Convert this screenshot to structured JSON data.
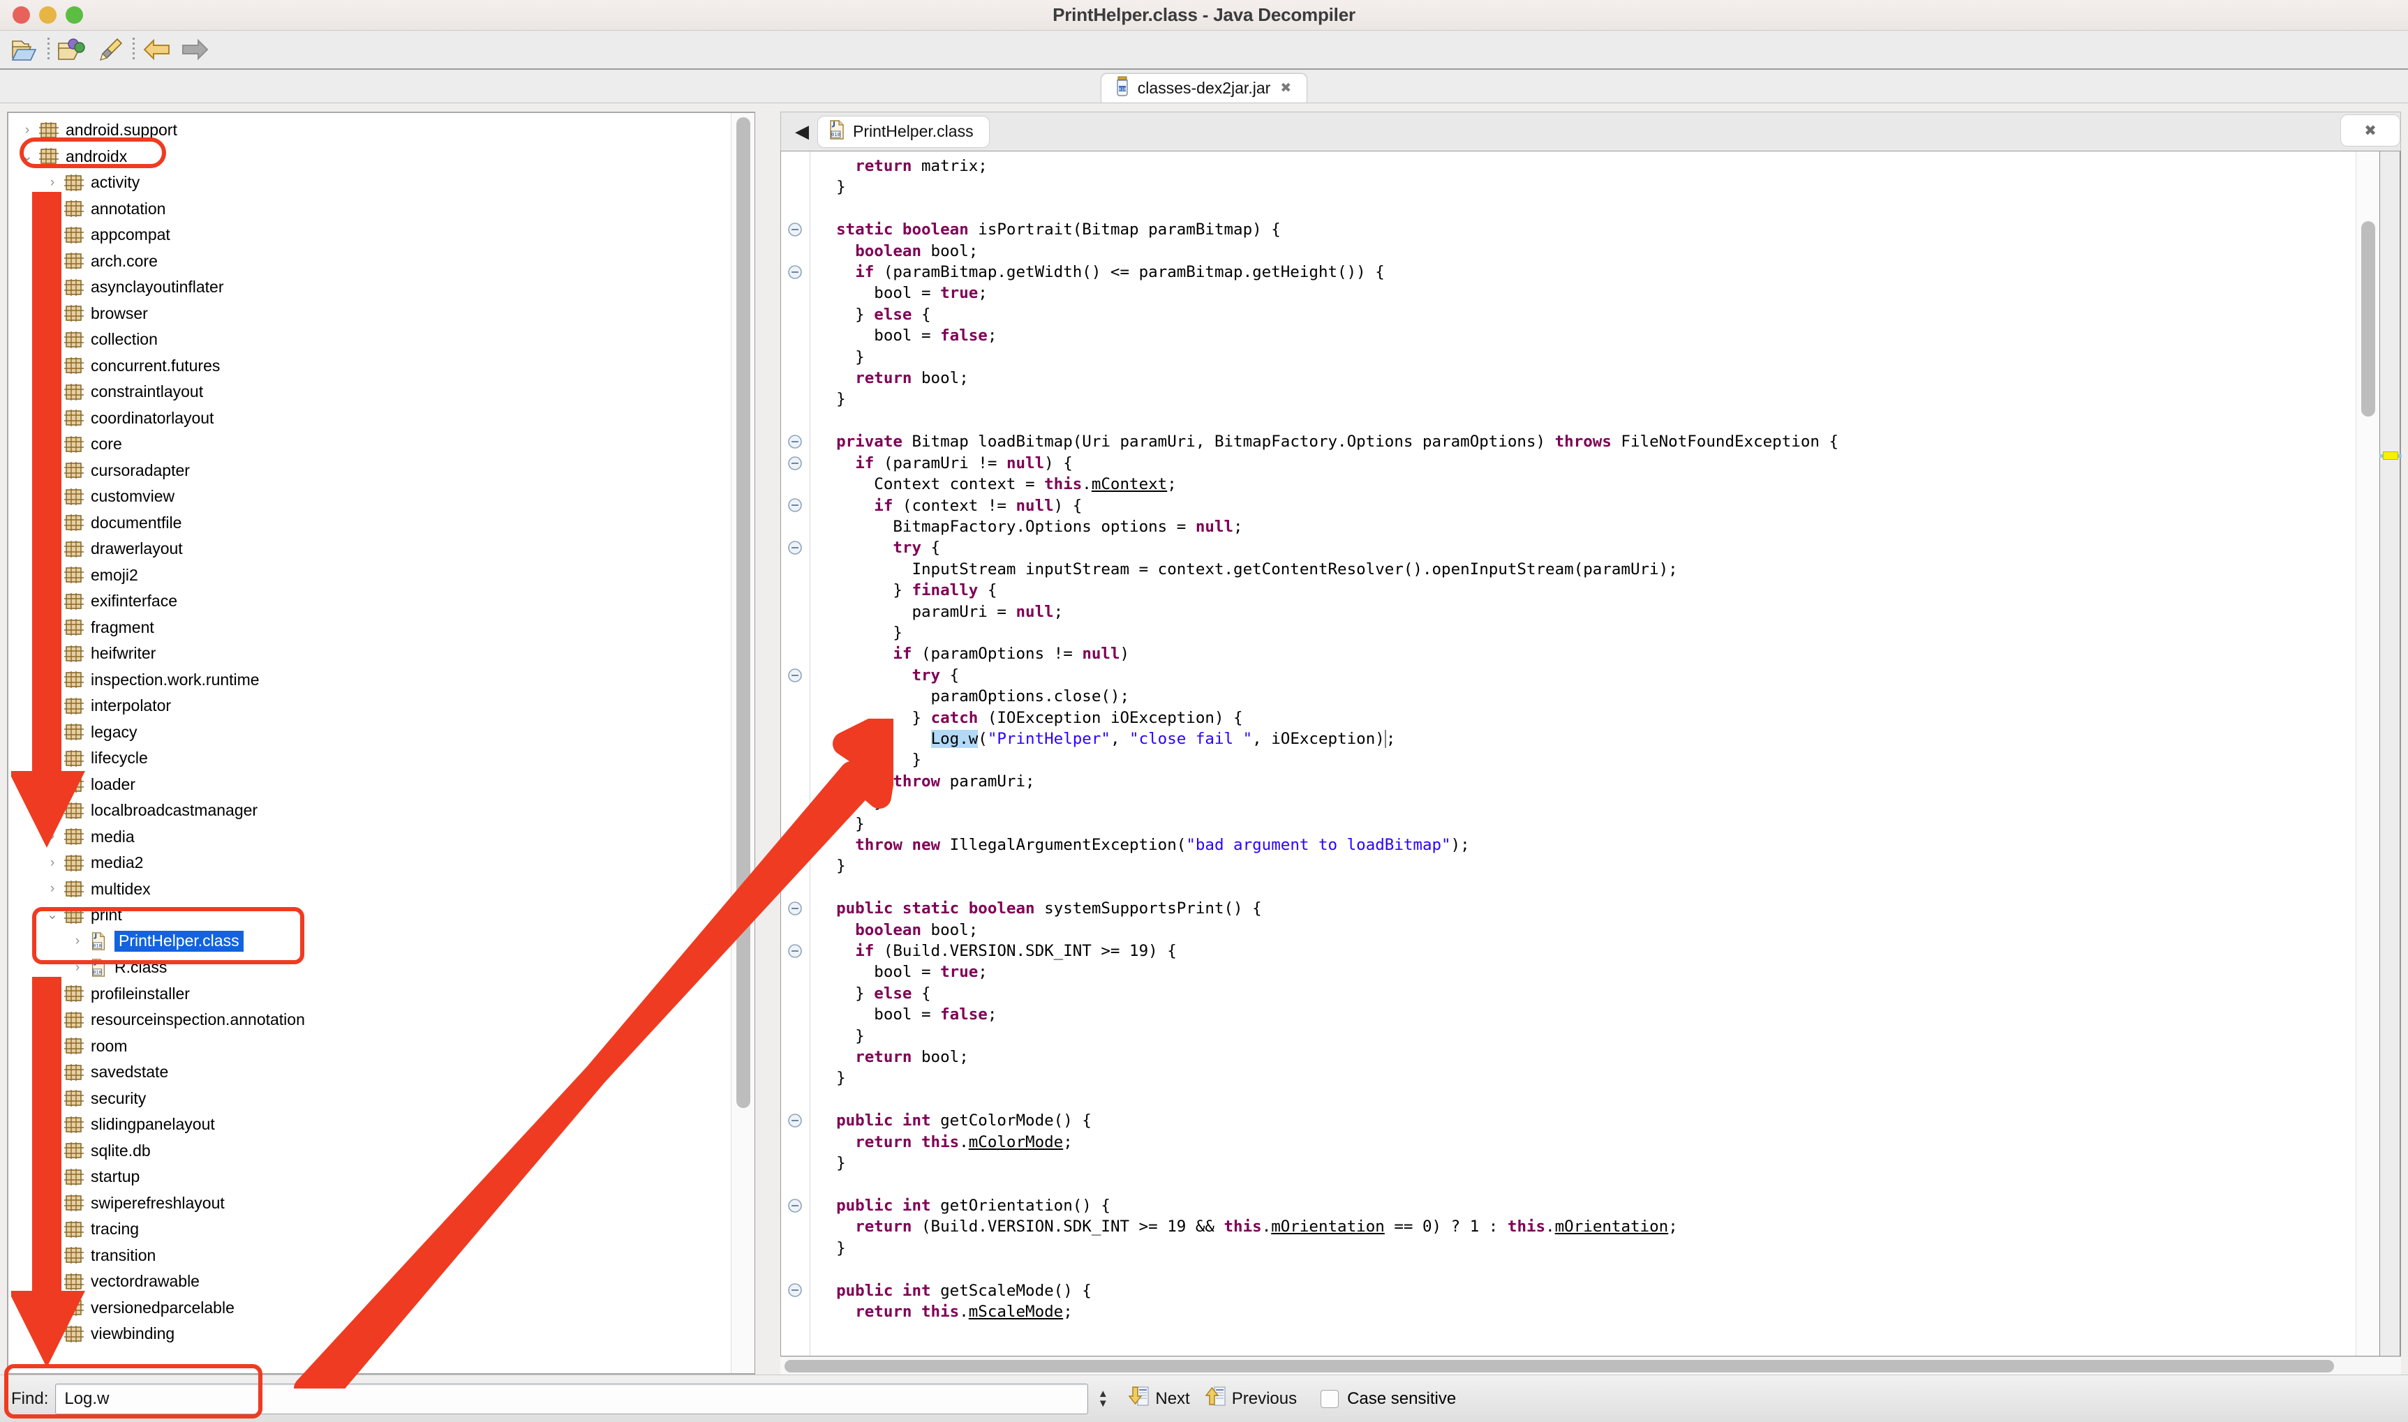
{
  "window": {
    "title": "PrintHelper.class - Java Decompiler",
    "traffic_lights": [
      "close-red",
      "minimize-yellow",
      "zoom-green"
    ]
  },
  "toolbar": {
    "buttons": [
      {
        "name": "open-file-icon",
        "label": "Open File"
      },
      {
        "name": "open-type-icon",
        "label": "Open Type"
      },
      {
        "name": "save-source-icon",
        "label": "Save Source"
      },
      {
        "name": "back-arrow-icon",
        "label": "Back"
      },
      {
        "name": "forward-arrow-icon",
        "label": "Forward"
      }
    ]
  },
  "jar_tabs": [
    {
      "label": "classes-dex2jar.jar",
      "icon": "jar-icon",
      "close": "✖",
      "active": true
    }
  ],
  "tree": {
    "items": [
      {
        "label": "android.support",
        "indent": 1,
        "state": "collapsed",
        "icon": "package-icon"
      },
      {
        "label": "androidx",
        "indent": 1,
        "state": "expanded",
        "icon": "package-icon",
        "annotated": true
      },
      {
        "label": "activity",
        "indent": 2,
        "state": "collapsed",
        "icon": "package-icon"
      },
      {
        "label": "annotation",
        "indent": 2,
        "state": "collapsed",
        "icon": "package-icon"
      },
      {
        "label": "appcompat",
        "indent": 2,
        "state": "collapsed",
        "icon": "package-icon"
      },
      {
        "label": "arch.core",
        "indent": 2,
        "state": "collapsed",
        "icon": "package-icon"
      },
      {
        "label": "asynclayoutinflater",
        "indent": 2,
        "state": "collapsed",
        "icon": "package-icon"
      },
      {
        "label": "browser",
        "indent": 2,
        "state": "collapsed",
        "icon": "package-icon"
      },
      {
        "label": "collection",
        "indent": 2,
        "state": "collapsed",
        "icon": "package-icon"
      },
      {
        "label": "concurrent.futures",
        "indent": 2,
        "state": "collapsed",
        "icon": "package-icon"
      },
      {
        "label": "constraintlayout",
        "indent": 2,
        "state": "collapsed",
        "icon": "package-icon"
      },
      {
        "label": "coordinatorlayout",
        "indent": 2,
        "state": "collapsed",
        "icon": "package-icon"
      },
      {
        "label": "core",
        "indent": 2,
        "state": "collapsed",
        "icon": "package-icon"
      },
      {
        "label": "cursoradapter",
        "indent": 2,
        "state": "collapsed",
        "icon": "package-icon"
      },
      {
        "label": "customview",
        "indent": 2,
        "state": "collapsed",
        "icon": "package-icon"
      },
      {
        "label": "documentfile",
        "indent": 2,
        "state": "collapsed",
        "icon": "package-icon"
      },
      {
        "label": "drawerlayout",
        "indent": 2,
        "state": "collapsed",
        "icon": "package-icon"
      },
      {
        "label": "emoji2",
        "indent": 2,
        "state": "collapsed",
        "icon": "package-icon"
      },
      {
        "label": "exifinterface",
        "indent": 2,
        "state": "collapsed",
        "icon": "package-icon"
      },
      {
        "label": "fragment",
        "indent": 2,
        "state": "collapsed",
        "icon": "package-icon"
      },
      {
        "label": "heifwriter",
        "indent": 2,
        "state": "collapsed",
        "icon": "package-icon"
      },
      {
        "label": "inspection.work.runtime",
        "indent": 2,
        "state": "collapsed",
        "icon": "package-icon"
      },
      {
        "label": "interpolator",
        "indent": 2,
        "state": "collapsed",
        "icon": "package-icon"
      },
      {
        "label": "legacy",
        "indent": 2,
        "state": "collapsed",
        "icon": "package-icon"
      },
      {
        "label": "lifecycle",
        "indent": 2,
        "state": "collapsed",
        "icon": "package-icon"
      },
      {
        "label": "loader",
        "indent": 2,
        "state": "collapsed",
        "icon": "package-icon"
      },
      {
        "label": "localbroadcastmanager",
        "indent": 2,
        "state": "collapsed",
        "icon": "package-icon"
      },
      {
        "label": "media",
        "indent": 2,
        "state": "collapsed",
        "icon": "package-icon"
      },
      {
        "label": "media2",
        "indent": 2,
        "state": "collapsed",
        "icon": "package-icon"
      },
      {
        "label": "multidex",
        "indent": 2,
        "state": "collapsed",
        "icon": "package-icon"
      },
      {
        "label": "print",
        "indent": 2,
        "state": "expanded",
        "icon": "package-icon",
        "annotated": true
      },
      {
        "label": "PrintHelper.class",
        "indent": 3,
        "state": "collapsed",
        "icon": "class-icon",
        "selected": true,
        "annotated": true
      },
      {
        "label": "R.class",
        "indent": 3,
        "state": "collapsed",
        "icon": "class-icon"
      },
      {
        "label": "profileinstaller",
        "indent": 2,
        "state": "collapsed",
        "icon": "package-icon"
      },
      {
        "label": "resourceinspection.annotation",
        "indent": 2,
        "state": "collapsed",
        "icon": "package-icon"
      },
      {
        "label": "room",
        "indent": 2,
        "state": "collapsed",
        "icon": "package-icon"
      },
      {
        "label": "savedstate",
        "indent": 2,
        "state": "collapsed",
        "icon": "package-icon"
      },
      {
        "label": "security",
        "indent": 2,
        "state": "collapsed",
        "icon": "package-icon"
      },
      {
        "label": "slidingpanelayout",
        "indent": 2,
        "state": "collapsed",
        "icon": "package-icon"
      },
      {
        "label": "sqlite.db",
        "indent": 2,
        "state": "collapsed",
        "icon": "package-icon"
      },
      {
        "label": "startup",
        "indent": 2,
        "state": "collapsed",
        "icon": "package-icon"
      },
      {
        "label": "swiperefreshlayout",
        "indent": 2,
        "state": "collapsed",
        "icon": "package-icon"
      },
      {
        "label": "tracing",
        "indent": 2,
        "state": "collapsed",
        "icon": "package-icon"
      },
      {
        "label": "transition",
        "indent": 2,
        "state": "collapsed",
        "icon": "package-icon"
      },
      {
        "label": "vectordrawable",
        "indent": 2,
        "state": "collapsed",
        "icon": "package-icon"
      },
      {
        "label": "versionedparcelable",
        "indent": 2,
        "state": "collapsed",
        "icon": "package-icon"
      },
      {
        "label": "viewbinding",
        "indent": 2,
        "state": "collapsed",
        "icon": "package-icon"
      }
    ]
  },
  "editor": {
    "back_arrow": "◀",
    "tab": {
      "label": "PrintHelper.class",
      "icon": "class-icon"
    },
    "close_icon": "✖",
    "code_lines": [
      [
        {
          "t": "    ",
          "c": ""
        },
        {
          "t": "return",
          "c": "kw"
        },
        {
          "t": " matrix;",
          "c": ""
        }
      ],
      [
        {
          "t": "  }",
          "c": ""
        }
      ],
      [],
      [
        {
          "t": "  ",
          "c": ""
        },
        {
          "t": "static boolean",
          "c": "kw"
        },
        {
          "t": " isPortrait(Bitmap paramBitmap) {",
          "c": ""
        }
      ],
      [
        {
          "t": "    ",
          "c": ""
        },
        {
          "t": "boolean",
          "c": "kw"
        },
        {
          "t": " bool;",
          "c": ""
        }
      ],
      [
        {
          "t": "    ",
          "c": ""
        },
        {
          "t": "if",
          "c": "kw"
        },
        {
          "t": " (paramBitmap.getWidth() <= paramBitmap.getHeight()) {",
          "c": ""
        }
      ],
      [
        {
          "t": "      bool = ",
          "c": ""
        },
        {
          "t": "true",
          "c": "kw"
        },
        {
          "t": ";",
          "c": ""
        }
      ],
      [
        {
          "t": "    } ",
          "c": ""
        },
        {
          "t": "else",
          "c": "kw"
        },
        {
          "t": " {",
          "c": ""
        }
      ],
      [
        {
          "t": "      bool = ",
          "c": ""
        },
        {
          "t": "false",
          "c": "kw"
        },
        {
          "t": ";",
          "c": ""
        }
      ],
      [
        {
          "t": "    }",
          "c": ""
        }
      ],
      [
        {
          "t": "    ",
          "c": ""
        },
        {
          "t": "return",
          "c": "kw"
        },
        {
          "t": " bool;",
          "c": ""
        }
      ],
      [
        {
          "t": "  }",
          "c": ""
        }
      ],
      [],
      [
        {
          "t": "  ",
          "c": ""
        },
        {
          "t": "private",
          "c": "kw"
        },
        {
          "t": " Bitmap loadBitmap(Uri paramUri, BitmapFactory.Options paramOptions) ",
          "c": ""
        },
        {
          "t": "throws",
          "c": "kw"
        },
        {
          "t": " FileNotFoundException {",
          "c": ""
        }
      ],
      [
        {
          "t": "    ",
          "c": ""
        },
        {
          "t": "if",
          "c": "kw"
        },
        {
          "t": " (paramUri != ",
          "c": ""
        },
        {
          "t": "null",
          "c": "kw"
        },
        {
          "t": ") {",
          "c": ""
        }
      ],
      [
        {
          "t": "      Context context = ",
          "c": ""
        },
        {
          "t": "this",
          "c": "kw"
        },
        {
          "t": ".",
          "c": ""
        },
        {
          "t": "mContext",
          "c": "fld"
        },
        {
          "t": ";",
          "c": ""
        }
      ],
      [
        {
          "t": "      ",
          "c": ""
        },
        {
          "t": "if",
          "c": "kw"
        },
        {
          "t": " (context != ",
          "c": ""
        },
        {
          "t": "null",
          "c": "kw"
        },
        {
          "t": ") {",
          "c": ""
        }
      ],
      [
        {
          "t": "        BitmapFactory.Options options = ",
          "c": ""
        },
        {
          "t": "null",
          "c": "kw"
        },
        {
          "t": ";",
          "c": ""
        }
      ],
      [
        {
          "t": "        ",
          "c": ""
        },
        {
          "t": "try",
          "c": "kw"
        },
        {
          "t": " {",
          "c": ""
        }
      ],
      [
        {
          "t": "          InputStream inputStream = context.getContentResolver().openInputStream(paramUri);",
          "c": ""
        }
      ],
      [
        {
          "t": "        } ",
          "c": ""
        },
        {
          "t": "finally",
          "c": "kw"
        },
        {
          "t": " {",
          "c": ""
        }
      ],
      [
        {
          "t": "          paramUri = ",
          "c": ""
        },
        {
          "t": "null",
          "c": "kw"
        },
        {
          "t": ";",
          "c": ""
        }
      ],
      [
        {
          "t": "        }",
          "c": ""
        }
      ],
      [
        {
          "t": "        ",
          "c": ""
        },
        {
          "t": "if",
          "c": "kw"
        },
        {
          "t": " (paramOptions != ",
          "c": ""
        },
        {
          "t": "null",
          "c": "kw"
        },
        {
          "t": ")",
          "c": ""
        }
      ],
      [
        {
          "t": "          ",
          "c": ""
        },
        {
          "t": "try",
          "c": "kw"
        },
        {
          "t": " {",
          "c": ""
        }
      ],
      [
        {
          "t": "            paramOptions.close();",
          "c": ""
        }
      ],
      [
        {
          "t": "          } ",
          "c": ""
        },
        {
          "t": "catch",
          "c": "kw"
        },
        {
          "t": " (IOException iOException) {",
          "c": ""
        }
      ],
      [
        {
          "t": "            ",
          "c": ""
        },
        {
          "t": "Log.w",
          "c": "hl"
        },
        {
          "t": "(",
          "c": ""
        },
        {
          "t": "\"PrintHelper\"",
          "c": "str"
        },
        {
          "t": ", ",
          "c": ""
        },
        {
          "t": "\"close fail \"",
          "c": "str"
        },
        {
          "t": ", iOException",
          "c": ""
        },
        {
          "t": ")",
          "c": "caret"
        },
        {
          "t": ";",
          "c": ""
        }
      ],
      [
        {
          "t": "          }",
          "c": ""
        }
      ],
      [
        {
          "t": "        ",
          "c": ""
        },
        {
          "t": "throw",
          "c": "kw"
        },
        {
          "t": " paramUri;",
          "c": ""
        }
      ],
      [
        {
          "t": "      }",
          "c": ""
        }
      ],
      [
        {
          "t": "    }",
          "c": ""
        }
      ],
      [
        {
          "t": "    ",
          "c": ""
        },
        {
          "t": "throw new",
          "c": "kw"
        },
        {
          "t": " IllegalArgumentException(",
          "c": ""
        },
        {
          "t": "\"bad argument to loadBitmap\"",
          "c": "str"
        },
        {
          "t": ");",
          "c": ""
        }
      ],
      [
        {
          "t": "  }",
          "c": ""
        }
      ],
      [],
      [
        {
          "t": "  ",
          "c": ""
        },
        {
          "t": "public static boolean",
          "c": "kw"
        },
        {
          "t": " systemSupportsPrint() {",
          "c": ""
        }
      ],
      [
        {
          "t": "    ",
          "c": ""
        },
        {
          "t": "boolean",
          "c": "kw"
        },
        {
          "t": " bool;",
          "c": ""
        }
      ],
      [
        {
          "t": "    ",
          "c": ""
        },
        {
          "t": "if",
          "c": "kw"
        },
        {
          "t": " (Build.VERSION.SDK_INT >= 19) {",
          "c": ""
        }
      ],
      [
        {
          "t": "      bool = ",
          "c": ""
        },
        {
          "t": "true",
          "c": "kw"
        },
        {
          "t": ";",
          "c": ""
        }
      ],
      [
        {
          "t": "    } ",
          "c": ""
        },
        {
          "t": "else",
          "c": "kw"
        },
        {
          "t": " {",
          "c": ""
        }
      ],
      [
        {
          "t": "      bool = ",
          "c": ""
        },
        {
          "t": "false",
          "c": "kw"
        },
        {
          "t": ";",
          "c": ""
        }
      ],
      [
        {
          "t": "    }",
          "c": ""
        }
      ],
      [
        {
          "t": "    ",
          "c": ""
        },
        {
          "t": "return",
          "c": "kw"
        },
        {
          "t": " bool;",
          "c": ""
        }
      ],
      [
        {
          "t": "  }",
          "c": ""
        }
      ],
      [],
      [
        {
          "t": "  ",
          "c": ""
        },
        {
          "t": "public int",
          "c": "kw"
        },
        {
          "t": " getColorMode() {",
          "c": ""
        }
      ],
      [
        {
          "t": "    ",
          "c": ""
        },
        {
          "t": "return",
          "c": "kw"
        },
        {
          "t": " ",
          "c": ""
        },
        {
          "t": "this",
          "c": "kw"
        },
        {
          "t": ".",
          "c": ""
        },
        {
          "t": "mColorMode",
          "c": "fld"
        },
        {
          "t": ";",
          "c": ""
        }
      ],
      [
        {
          "t": "  }",
          "c": ""
        }
      ],
      [],
      [
        {
          "t": "  ",
          "c": ""
        },
        {
          "t": "public int",
          "c": "kw"
        },
        {
          "t": " getOrientation() {",
          "c": ""
        }
      ],
      [
        {
          "t": "    ",
          "c": ""
        },
        {
          "t": "return",
          "c": "kw"
        },
        {
          "t": " (Build.VERSION.SDK_INT >= 19 && ",
          "c": ""
        },
        {
          "t": "this",
          "c": "kw"
        },
        {
          "t": ".",
          "c": ""
        },
        {
          "t": "mOrientation",
          "c": "fld"
        },
        {
          "t": " == 0) ? 1 : ",
          "c": ""
        },
        {
          "t": "this",
          "c": "kw"
        },
        {
          "t": ".",
          "c": ""
        },
        {
          "t": "mOrientation",
          "c": "fld"
        },
        {
          "t": ";",
          "c": ""
        }
      ],
      [
        {
          "t": "  }",
          "c": ""
        }
      ],
      [],
      [
        {
          "t": "  ",
          "c": ""
        },
        {
          "t": "public int",
          "c": "kw"
        },
        {
          "t": " getScaleMode() {",
          "c": ""
        }
      ],
      [
        {
          "t": "    ",
          "c": ""
        },
        {
          "t": "return",
          "c": "kw"
        },
        {
          "t": " ",
          "c": ""
        },
        {
          "t": "this",
          "c": "kw"
        },
        {
          "t": ".",
          "c": ""
        },
        {
          "t": "mScaleMode",
          "c": "fld"
        },
        {
          "t": ";",
          "c": ""
        }
      ]
    ],
    "fold_lines": [
      3,
      5,
      13,
      14,
      16,
      18,
      24,
      35,
      37,
      45,
      49,
      53
    ]
  },
  "find": {
    "label": "Find:",
    "value": "Log.w",
    "placeholder": "",
    "next_label": "Next",
    "previous_label": "Previous",
    "case_sensitive_label": "Case sensitive",
    "case_sensitive_checked": false
  },
  "annotations": {
    "color": "#ef3b21",
    "boxes": [
      "androidx-tree-item",
      "print-tree-item",
      "find-input"
    ],
    "arrows": [
      "down-arrow-upper",
      "down-arrow-lower",
      "pointer-to-logw"
    ]
  },
  "colors": {
    "keyword": "#7f0055",
    "string": "#2a00ff",
    "selection": "#1263dd",
    "search_highlight": "#b3d9f5",
    "annotation": "#ef3b21",
    "marker": "#f7f000"
  }
}
